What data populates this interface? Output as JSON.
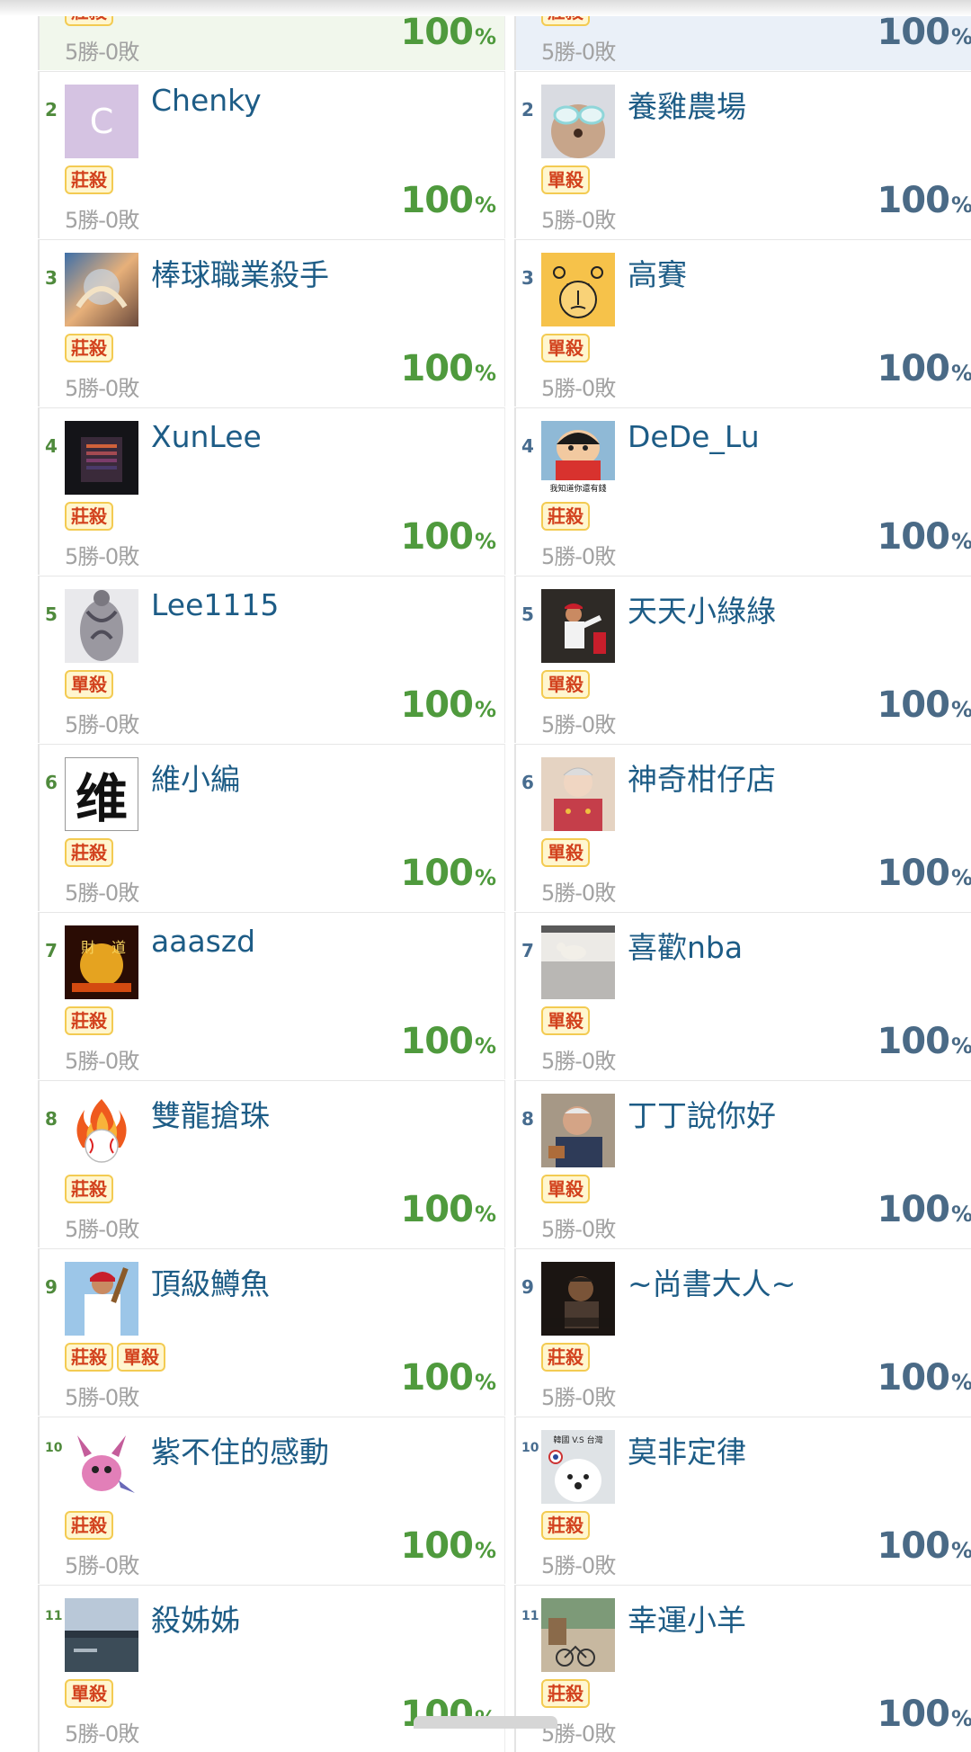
{
  "left_column": [
    {
      "rank": "",
      "name": "",
      "badges": [
        "莊殺"
      ],
      "record": "5勝-0敗",
      "win_rate": "100",
      "pct_sign": "%",
      "avatar": "none-icon"
    },
    {
      "rank": "2",
      "name": "Chenky",
      "badges": [
        "莊殺"
      ],
      "record": "5勝-0敗",
      "win_rate": "100",
      "pct_sign": "%",
      "avatar": "letter-c-avatar",
      "avatar_letter": "C"
    },
    {
      "rank": "3",
      "name": "棒球職業殺手",
      "badges": [
        "莊殺"
      ],
      "record": "5勝-0敗",
      "win_rate": "100",
      "pct_sign": "%",
      "avatar": "dragon-avatar"
    },
    {
      "rank": "4",
      "name": "XunLee",
      "badges": [
        "莊殺"
      ],
      "record": "5勝-0敗",
      "win_rate": "100",
      "pct_sign": "%",
      "avatar": "dark-building-avatar"
    },
    {
      "rank": "5",
      "name": "Lee1115",
      "badges": [
        "單殺"
      ],
      "record": "5勝-0敗",
      "win_rate": "100",
      "pct_sign": "%",
      "avatar": "tattoo-avatar"
    },
    {
      "rank": "6",
      "name": "維小編",
      "badges": [
        "莊殺"
      ],
      "record": "5勝-0敗",
      "win_rate": "100",
      "pct_sign": "%",
      "avatar": "calligraphy-avatar",
      "avatar_char": "维"
    },
    {
      "rank": "7",
      "name": "aaaszd",
      "badges": [
        "莊殺"
      ],
      "record": "5勝-0敗",
      "win_rate": "100",
      "pct_sign": "%",
      "avatar": "fortune-avatar",
      "avatar_chars": [
        "財",
        "道"
      ]
    },
    {
      "rank": "8",
      "name": "雙龍搶珠",
      "badges": [
        "莊殺"
      ],
      "record": "5勝-0敗",
      "win_rate": "100",
      "pct_sign": "%",
      "avatar": "flaming-baseball-icon"
    },
    {
      "rank": "9",
      "name": "頂級鱒魚",
      "badges": [
        "莊殺",
        "單殺"
      ],
      "record": "5勝-0敗",
      "win_rate": "100",
      "pct_sign": "%",
      "avatar": "baseball-player-avatar"
    },
    {
      "rank": "10",
      "name": "紫不住的感動",
      "badges": [
        "莊殺"
      ],
      "record": "5勝-0敗",
      "win_rate": "100",
      "pct_sign": "%",
      "avatar": "pink-creature-avatar"
    },
    {
      "rank": "11",
      "name": "殺姊姊",
      "badges": [
        "單殺"
      ],
      "record": "5勝-0敗",
      "win_rate": "100",
      "pct_sign": "%",
      "avatar": "lake-avatar"
    }
  ],
  "right_column": [
    {
      "rank": "",
      "name": "",
      "badges": [
        "莊殺"
      ],
      "record": "5勝-0敗",
      "win_rate": "100",
      "pct_sign": "%",
      "avatar": "none-icon"
    },
    {
      "rank": "2",
      "name": "養雞農場",
      "badges": [
        "單殺"
      ],
      "record": "5勝-0敗",
      "win_rate": "100",
      "pct_sign": "%",
      "avatar": "dog-sunglasses-avatar"
    },
    {
      "rank": "3",
      "name": "高賽",
      "badges": [
        "單殺"
      ],
      "record": "5勝-0敗",
      "win_rate": "100",
      "pct_sign": "%",
      "avatar": "bear-face-avatar"
    },
    {
      "rank": "4",
      "name": "DeDe_Lu",
      "badges": [
        "莊殺"
      ],
      "record": "5勝-0敗",
      "win_rate": "100",
      "pct_sign": "%",
      "avatar": "cartoon-boy-avatar",
      "avatar_caption": "我知道你還有錢"
    },
    {
      "rank": "5",
      "name": "天天小綠綠",
      "badges": [
        "單殺"
      ],
      "record": "5勝-0敗",
      "win_rate": "100",
      "pct_sign": "%",
      "avatar": "pitcher-avatar"
    },
    {
      "rank": "6",
      "name": "神奇柑仔店",
      "badges": [
        "單殺"
      ],
      "record": "5勝-0敗",
      "win_rate": "100",
      "pct_sign": "%",
      "avatar": "old-lady-avatar"
    },
    {
      "rank": "7",
      "name": "喜歡nba",
      "badges": [
        "單殺"
      ],
      "record": "5勝-0敗",
      "win_rate": "100",
      "pct_sign": "%",
      "avatar": "dog-floor-avatar"
    },
    {
      "rank": "8",
      "name": "丁丁說你好",
      "badges": [
        "單殺"
      ],
      "record": "5勝-0敗",
      "win_rate": "100",
      "pct_sign": "%",
      "avatar": "old-man-avatar"
    },
    {
      "rank": "9",
      "name": "~尚書大人~",
      "badges": [
        "莊殺"
      ],
      "record": "5勝-0敗",
      "win_rate": "100",
      "pct_sign": "%",
      "avatar": "movie-still-avatar"
    },
    {
      "rank": "10",
      "name": "莫非定律",
      "badges": [
        "莊殺"
      ],
      "record": "5勝-0敗",
      "win_rate": "100",
      "pct_sign": "%",
      "avatar": "samoyed-avatar",
      "avatar_caption": "韓國 V.S 台灣"
    },
    {
      "rank": "11",
      "name": "幸運小羊",
      "badges": [
        "莊殺"
      ],
      "record": "5勝-0敗",
      "win_rate": "100",
      "pct_sign": "%",
      "avatar": "street-bike-avatar"
    }
  ],
  "colors": {
    "left_accent": "#4f9a3d",
    "right_accent": "#4a6a86",
    "name": "#1d5c86",
    "badge_text": "#d2411d",
    "badge_bg": "#fff6cf",
    "badge_border": "#f3cb52",
    "record": "#a2a2a2"
  }
}
